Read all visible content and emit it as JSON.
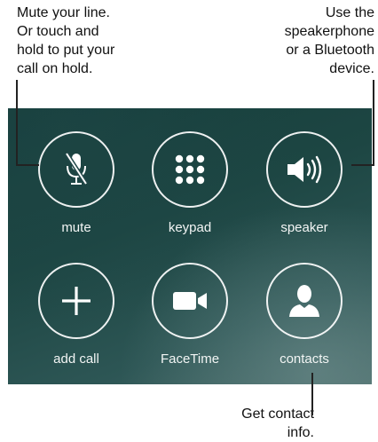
{
  "callouts": {
    "mute_help": [
      "Mute your line.",
      "Or touch and",
      "hold to put your",
      "call on hold."
    ],
    "speaker_help": [
      "Use the",
      "speakerphone",
      "or a Bluetooth",
      "device."
    ],
    "contacts_help": [
      "Get contact",
      "info."
    ]
  },
  "buttons": {
    "mute": {
      "label": "mute",
      "icon": "microphone-slash-icon"
    },
    "keypad": {
      "label": "keypad",
      "icon": "keypad-grid-icon"
    },
    "speaker": {
      "label": "speaker",
      "icon": "speaker-waves-icon"
    },
    "add_call": {
      "label": "add call",
      "icon": "plus-icon"
    },
    "facetime": {
      "label": "FaceTime",
      "icon": "video-camera-icon"
    },
    "contacts": {
      "label": "contacts",
      "icon": "person-silhouette-icon"
    }
  },
  "colors": {
    "panel_dark": "#163e3b",
    "panel_light": "#456866",
    "ring": "#ffffff",
    "label": "#f2f5f4",
    "callout_text": "#111111"
  }
}
